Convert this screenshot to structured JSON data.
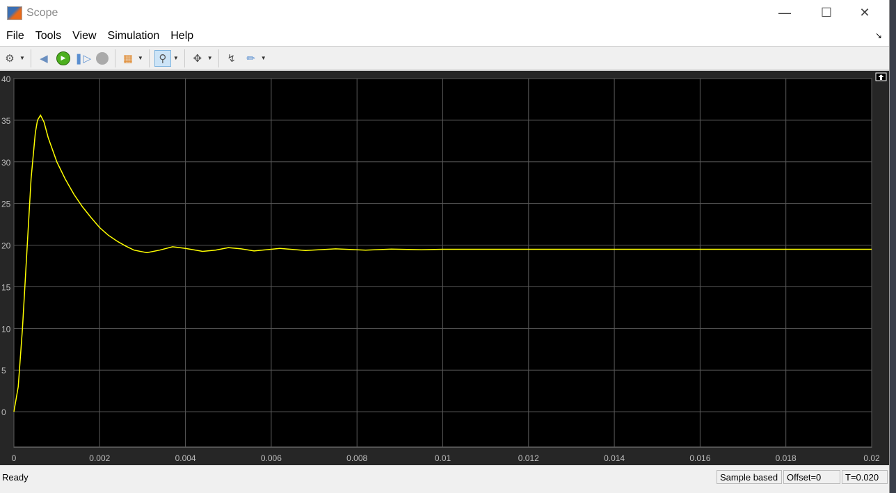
{
  "window": {
    "title": "Scope"
  },
  "menu": [
    "File",
    "Tools",
    "View",
    "Simulation",
    "Help"
  ],
  "toolbar": [
    "gear-icon",
    "step-back-icon",
    "run-icon",
    "step-forward-icon",
    "stop-icon",
    "signal-select-icon",
    "zoom-x-icon",
    "autoscale-icon",
    "trigger-icon",
    "cursor-measure-icon"
  ],
  "status": {
    "left": "Ready",
    "mode": "Sample based",
    "offset": "Offset=0",
    "time": "T=0.020"
  },
  "colors": {
    "trace": "#ffff00",
    "background": "#000000",
    "grid": "#5a5a5a"
  },
  "chart_data": {
    "type": "line",
    "xlim": [
      0,
      0.02
    ],
    "ylim": [
      -4.25,
      40
    ],
    "grid": true,
    "xticks": [
      "0",
      "0.002",
      "0.004",
      "0.006",
      "0.008",
      "0.01",
      "0.012",
      "0.014",
      "0.016",
      "0.018",
      "0.02"
    ],
    "yticks": [
      "0",
      "5",
      "10",
      "15",
      "20",
      "25",
      "30",
      "35",
      "40"
    ],
    "series": [
      {
        "color": "#ffff00",
        "points": [
          [
            0,
            0
          ],
          [
            0.0001,
            3
          ],
          [
            0.0002,
            10
          ],
          [
            0.0003,
            19
          ],
          [
            0.0004,
            28
          ],
          [
            0.0005,
            33.5
          ],
          [
            0.00055,
            35
          ],
          [
            0.00062,
            35.6
          ],
          [
            0.0007,
            34.8
          ],
          [
            0.0008,
            32.9
          ],
          [
            0.001,
            30
          ],
          [
            0.0012,
            27.9
          ],
          [
            0.0014,
            26.1
          ],
          [
            0.0016,
            24.6
          ],
          [
            0.0018,
            23.3
          ],
          [
            0.002,
            22.1
          ],
          [
            0.0022,
            21.2
          ],
          [
            0.0024,
            20.5
          ],
          [
            0.0026,
            19.9
          ],
          [
            0.0028,
            19.4
          ],
          [
            0.0031,
            19.1
          ],
          [
            0.0034,
            19.4
          ],
          [
            0.0037,
            19.8
          ],
          [
            0.004,
            19.6
          ],
          [
            0.0044,
            19.25
          ],
          [
            0.0047,
            19.4
          ],
          [
            0.005,
            19.7
          ],
          [
            0.0053,
            19.55
          ],
          [
            0.0056,
            19.3
          ],
          [
            0.0062,
            19.6
          ],
          [
            0.0068,
            19.35
          ],
          [
            0.0075,
            19.55
          ],
          [
            0.0082,
            19.4
          ],
          [
            0.0088,
            19.52
          ],
          [
            0.0095,
            19.45
          ],
          [
            0.01,
            19.5
          ],
          [
            0.02,
            19.5
          ]
        ]
      }
    ]
  }
}
